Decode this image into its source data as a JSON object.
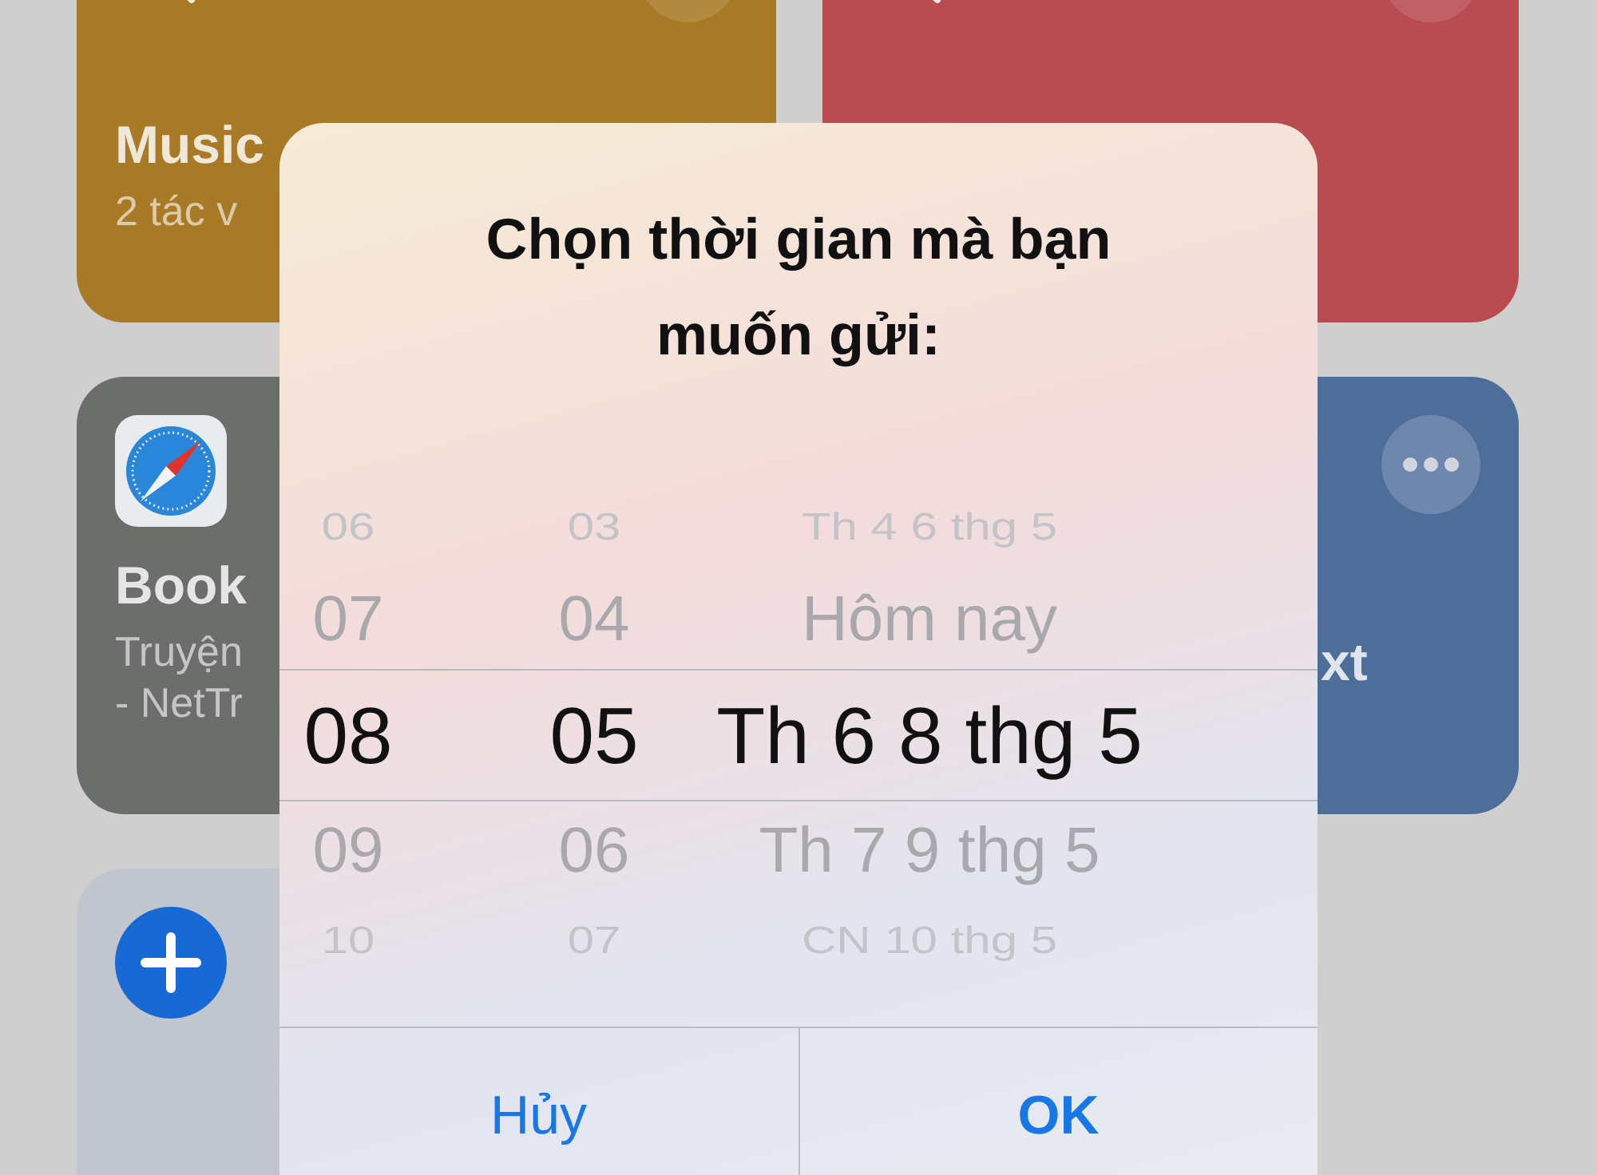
{
  "cards": [
    {
      "kind": "wand",
      "color": "#a87a26",
      "title": "Music",
      "subtitle": [
        "2 tác v"
      ]
    },
    {
      "kind": "wand",
      "color": "#b84c50"
    },
    {
      "kind": "compass",
      "color": "#6b6e6b",
      "title": "Book",
      "subtitle": [
        "Truyện",
        "- NetTr"
      ]
    },
    {
      "kind": "more",
      "color": "#4e6e9a",
      "title": "xt"
    },
    {
      "kind": "plus",
      "color": "#c1c5cd"
    }
  ],
  "dialog": {
    "title": "Chọn thời gian mà bạn muốn gửi:",
    "picker": {
      "rows": [
        {
          "hour": "06",
          "minute": "03",
          "date": "Th 4 6 thg 5",
          "selected": false
        },
        {
          "hour": "07",
          "minute": "04",
          "date": "Hôm nay",
          "selected": false
        },
        {
          "hour": "08",
          "minute": "05",
          "date": "Th 6 8 thg 5",
          "selected": true
        },
        {
          "hour": "09",
          "minute": "06",
          "date": "Th 7 9 thg 5",
          "selected": false
        },
        {
          "hour": "10",
          "minute": "07",
          "date": "CN 10 thg 5",
          "selected": false
        }
      ]
    },
    "buttons": [
      {
        "label": "Hủy",
        "kind": "cancel"
      },
      {
        "label": "OK",
        "kind": "default"
      }
    ]
  }
}
